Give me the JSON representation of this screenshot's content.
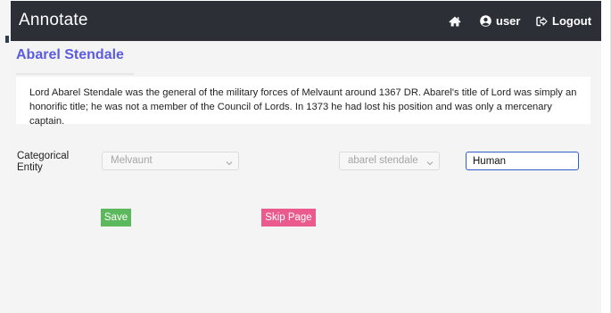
{
  "navbar": {
    "brand": "Annotate",
    "home_icon": "home-icon",
    "user_icon": "user-circle-icon",
    "user_label": "user",
    "logout_icon": "sign-out-icon",
    "logout_label": "Logout"
  },
  "page": {
    "title": "Abarel Stendale",
    "description": "Lord Abarel Stendale was the general of the military forces of Melvaunt around 1367 DR. Abarel's title of Lord was simply an honorific title; he was not a member of the Council of Lords. In 1373 he had lost his position and was only a mercenary captain."
  },
  "form": {
    "row_label": "Categorical Entity",
    "select_1_value": "Melvaunt",
    "select_2_value": "abarel stendale",
    "chevron_icon": "chevron-down-icon",
    "text_input_value": "Human",
    "save_label": "Save",
    "skip_label": "Skip Page"
  },
  "colors": {
    "navbar_bg": "#2c3036",
    "title": "#5b5ce0",
    "save_button": "#5cb85c",
    "skip_button": "#ea5a8d",
    "input_focus_border": "#2d5fc9"
  }
}
